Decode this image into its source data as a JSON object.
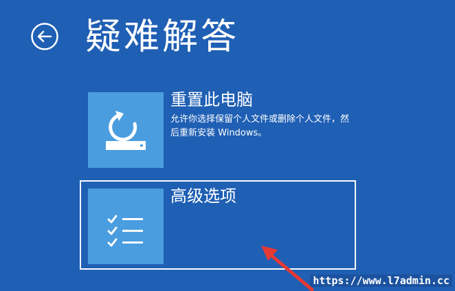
{
  "page": {
    "title": "疑难解答",
    "back_icon": "back-arrow-icon"
  },
  "options": [
    {
      "title": "重置此电脑",
      "description": "允许你选择保留个人文件或删除个人文件，然后重新安装 Windows。",
      "icon": "reset-pc-icon"
    },
    {
      "title": "高级选项",
      "description": "",
      "icon": "checklist-icon",
      "selected": true
    }
  ],
  "annotation": {
    "icon": "red-arrow-icon"
  },
  "watermark": "https://www.l7admin.cc",
  "colors": {
    "background": "#1f5fb4",
    "tile": "#4a9ddf",
    "text": "#ffffff",
    "annotation": "#e53935"
  }
}
